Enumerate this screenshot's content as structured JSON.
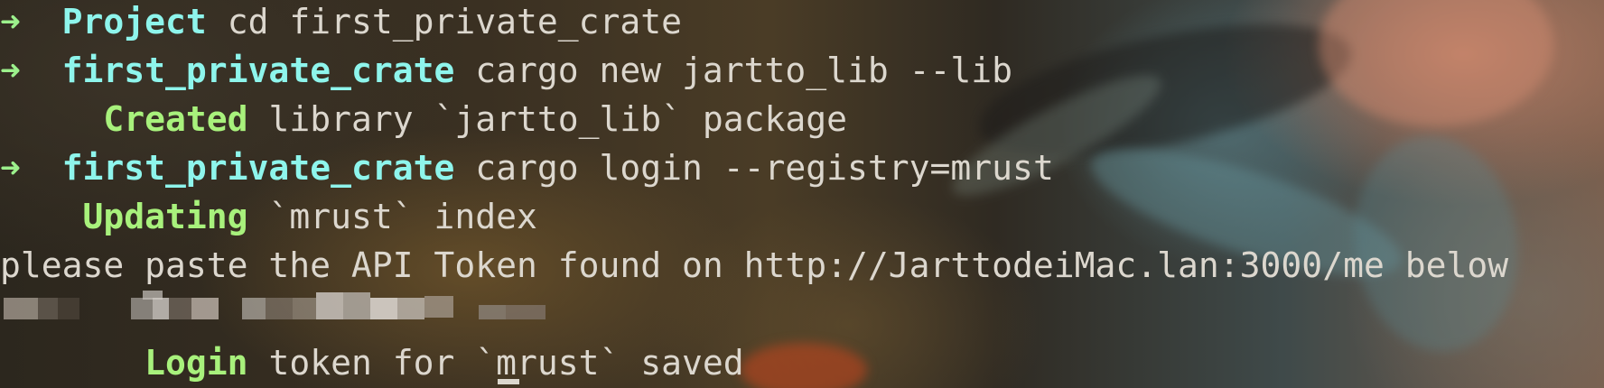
{
  "terminal": {
    "lines": [
      {
        "arrow": "➜",
        "dir": "Project",
        "cmd": "cd first_private_crate"
      },
      {
        "arrow": "➜",
        "dir": "first_private_crate",
        "cmd": "cargo new jartto_lib --lib"
      },
      {
        "indent": "     ",
        "status": "Created",
        "text": "library `jartto_lib` package"
      },
      {
        "arrow": "➜",
        "dir": "first_private_crate",
        "cmd": "cargo login --registry=mrust"
      },
      {
        "indent": "    ",
        "status": "Updating",
        "text": "`mrust` index"
      },
      {
        "text": "please paste the API Token found on http://JarttodeiMac.lan:3000/me below"
      },
      {
        "redacted": true
      },
      {
        "indent": "       ",
        "status": "Login",
        "text": "token for `mrust` saved"
      }
    ]
  },
  "colors": {
    "arrow": "#9cf08c",
    "directory": "#8ef5ec",
    "status": "#a8f17c",
    "text": "#dcd7ce"
  }
}
